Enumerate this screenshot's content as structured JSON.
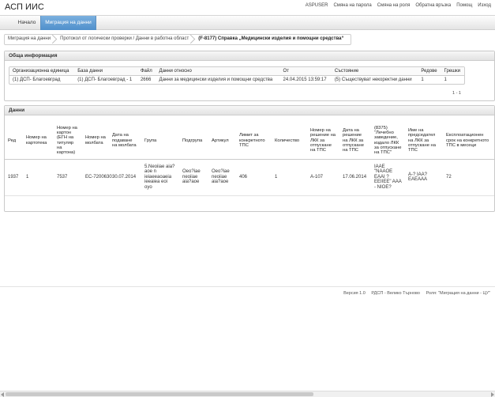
{
  "app": {
    "title": "АСП ИИС"
  },
  "top_links": [
    "ASPUSER",
    "Смяна на парола",
    "Смяна на роля",
    "Обратна връзка",
    "Помощ",
    "Изход"
  ],
  "nav": {
    "home": "Начало",
    "active": "Миграция на данни"
  },
  "breadcrumb": [
    "Миграция на данни",
    "Протокол от логически проверки / Данни в работна област",
    "(F-8177) Справка „Медицински изделия и помощни средства“"
  ],
  "general": {
    "title": "Обща информация",
    "columns": [
      "Организационна единица",
      "База данни",
      "Файл",
      "Данни относно",
      "От",
      "Състояние",
      "Редове",
      "Грешки"
    ],
    "row": [
      "(1) ДСП- Благоевград",
      "(1) ДСП- Благоевград - 1",
      "2666",
      "Данни за медицински изделия и помощни средства",
      "24.04.2015 13:59:17",
      "(5) Съществуват некоректни данни",
      "1",
      "1"
    ],
    "pager": "1 - 1"
  },
  "data": {
    "title": "Данни",
    "columns": [
      "Ред",
      "Номер на картотека",
      "Номер на картон (ЕГН на титуляр на картона)",
      "Номер на молбата",
      "Дата на подаване на молбата",
      "Група",
      "Подгрупа",
      "Артикул",
      "Лимит за конкретното ТПС",
      "Количество",
      "Номер на решение на ЛКК за отпускане на ТПС",
      "Дата на решение на ЛКК за отпускане на ТПС",
      "(8375) \"Лечебно заведение, издало ЛКК за отпускане на ТПС\"",
      "Име на председател на ЛКК за отпускане на ТПС",
      "Експлоатационен срок на конкретното ТПС в месеци"
    ],
    "row": [
      "1937",
      "1",
      "7537",
      "ЕС-7200630",
      "30.07.2014",
      "5.Neoiiae aia?aoe n ieiaeeaoaeia ieeaiea eoi oyo",
      "Oeo?iae neoiiae aia?aoe",
      "Oeo?iae neoiiae aia?aoe",
      "406",
      "1",
      "А-107",
      "17.06.2014",
      "IAAE \"NAAOE EAAI ? EEIIEE\" AAA - NIOE?",
      "А-? IAA? EAEAAA",
      "72"
    ]
  },
  "footer": {
    "version": "Версия 1.0",
    "office": "РДСП - Велико Търново",
    "role": "Роля: \"Миграция на данни - ЦУ\""
  }
}
